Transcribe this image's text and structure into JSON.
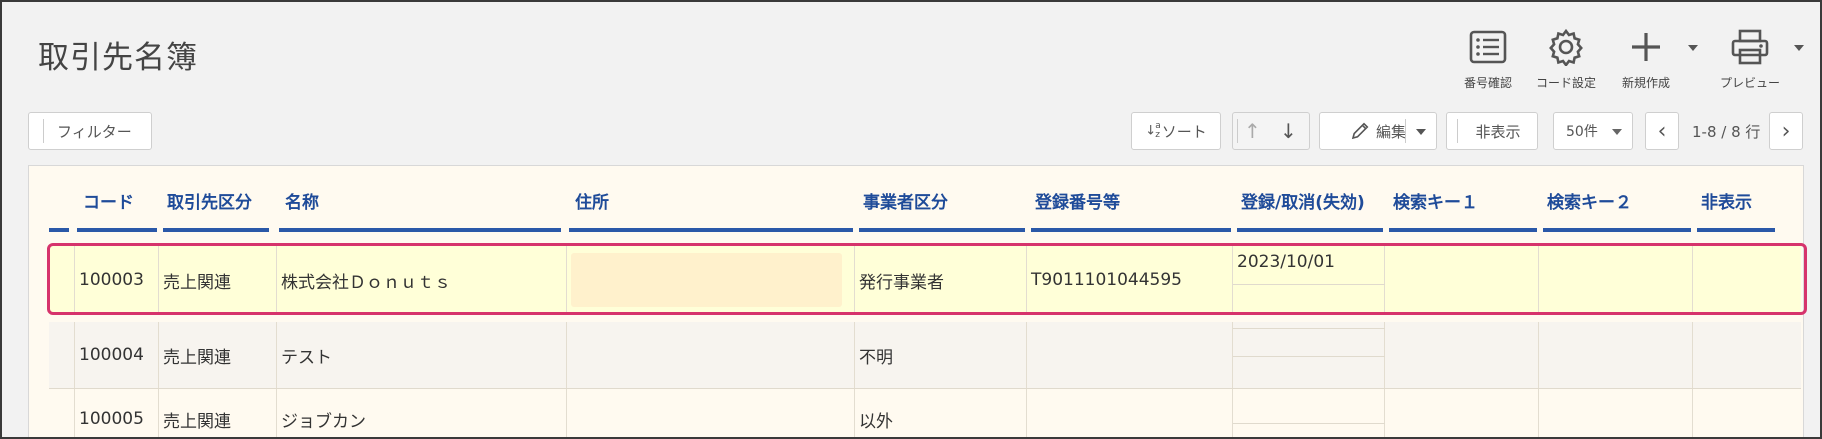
{
  "page": {
    "title": "取引先名簿"
  },
  "toolbar": {
    "number_check": {
      "label": "番号確認",
      "icon": "list-icon"
    },
    "code_settings": {
      "label": "コード設定",
      "icon": "gear-icon"
    },
    "new_create": {
      "label": "新規作成",
      "icon": "plus-icon"
    },
    "preview": {
      "label": "プレビュー",
      "icon": "printer-icon"
    }
  },
  "controls": {
    "filter_label": "フィルター",
    "sort_label": "ソート",
    "sort_icon_text": "↓",
    "sort_icon_sub": "a z",
    "up_arrow": "↑",
    "down_arrow": "↓",
    "edit_label": "編集",
    "hide_label": "非表示",
    "page_size": "50件",
    "prev": "‹",
    "next": "›",
    "range": "1-8 / 8 行"
  },
  "columns": [
    "コード",
    "取引先区分",
    "名称",
    "住所",
    "事業者区分",
    "登録番号等",
    "登録/取消(失効)",
    "検索キー１",
    "検索キー２",
    "非表示"
  ],
  "rows": [
    {
      "code": "100003",
      "category": "売上関連",
      "name": "株式会社Ｄｏｎｕｔｓ",
      "address": "",
      "business_type": "発行事業者",
      "reg_no": "T9011101044595",
      "reg_date": "2023/10/01",
      "key1": "",
      "key2": "",
      "hidden": ""
    },
    {
      "code": "100004",
      "category": "売上関連",
      "name": "テスト",
      "address": "",
      "business_type": "不明",
      "reg_no": "",
      "reg_date": "",
      "key1": "",
      "key2": "",
      "hidden": ""
    },
    {
      "code": "100005",
      "category": "売上関連",
      "name": "ジョブカン",
      "address": "",
      "business_type": "以外",
      "reg_no": "",
      "reg_date": "",
      "key1": "",
      "key2": "",
      "hidden": ""
    }
  ],
  "colors": {
    "header_text": "#1f4b99",
    "selected_row_bg": "#ffffd8",
    "selection_border": "#d6336c",
    "row_bg": "#fffaf0"
  }
}
